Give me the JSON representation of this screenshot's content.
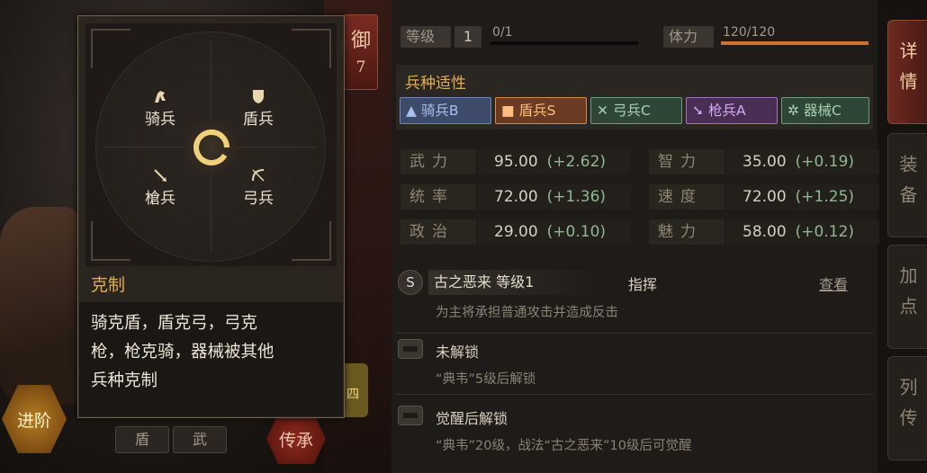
{
  "left": {
    "defense_badge": {
      "char": "御",
      "value": "7"
    },
    "advance_button": "进阶",
    "chips": [
      "盾",
      "武"
    ],
    "inherit_button": "传承",
    "side_tab": "四"
  },
  "tooltip": {
    "units": {
      "cavalry": {
        "label": "骑兵"
      },
      "shield": {
        "label": "盾兵"
      },
      "spear": {
        "label": "槍兵"
      },
      "archer": {
        "label": "弓兵"
      }
    },
    "counter_title": "克制",
    "counter_lines": [
      "骑克盾，盾克弓，弓克",
      "枪，枪克骑，器械被其他",
      "兵种克制"
    ]
  },
  "panel": {
    "level_label": "等级",
    "level_value": "1",
    "exp_text": "0/1",
    "stamina_label": "体力",
    "stamina_text": "120/120",
    "stamina_fraction": 1.0,
    "exp_fraction": 0.0,
    "aptitude_title": "兵种适性",
    "aptitudes": [
      {
        "icon": "▲",
        "label": "骑兵B",
        "color": "#3d4a6a",
        "border": "#6f83b5",
        "text": "#a9c0ee"
      },
      {
        "icon": "■",
        "label": "盾兵S",
        "color": "#6a3b22",
        "border": "#d7894c",
        "text": "#ffbd7e"
      },
      {
        "icon": "✕",
        "label": "弓兵C",
        "color": "#2f4537",
        "border": "#6f9b7c",
        "text": "#a5d2b0"
      },
      {
        "icon": "➘",
        "label": "枪兵A",
        "color": "#4a2f55",
        "border": "#a072bb",
        "text": "#d6aaf0"
      },
      {
        "icon": "✲",
        "label": "器械C",
        "color": "#2f4537",
        "border": "#6f9b7c",
        "text": "#a5d2b0"
      }
    ],
    "stats_left": [
      {
        "label": "武力",
        "value": "95.00",
        "bonus": "(+2.62)"
      },
      {
        "label": "统率",
        "value": "72.00",
        "bonus": "(+1.36)"
      },
      {
        "label": "政治",
        "value": "29.00",
        "bonus": "(+0.10)"
      }
    ],
    "stats_right": [
      {
        "label": "智力",
        "value": "35.00",
        "bonus": "(+0.19)"
      },
      {
        "label": "速度",
        "value": "72.00",
        "bonus": "(+1.25)"
      },
      {
        "label": "魅力",
        "value": "58.00",
        "bonus": "(+0.12)"
      }
    ],
    "skill1": {
      "grade": "S",
      "name": "古之恶来 等级1",
      "type": "指挥",
      "view": "查看",
      "desc": "为主将承担普通攻击并造成反击"
    },
    "skill2": {
      "name": "未解锁",
      "desc": "“典韦”5级后解锁"
    },
    "skill3": {
      "name": "觉醒后解锁",
      "desc": "“典韦”20级，战法“古之恶来”10级后可觉醒"
    }
  },
  "tabs": [
    "详情",
    "装备",
    "加点",
    "列传"
  ]
}
